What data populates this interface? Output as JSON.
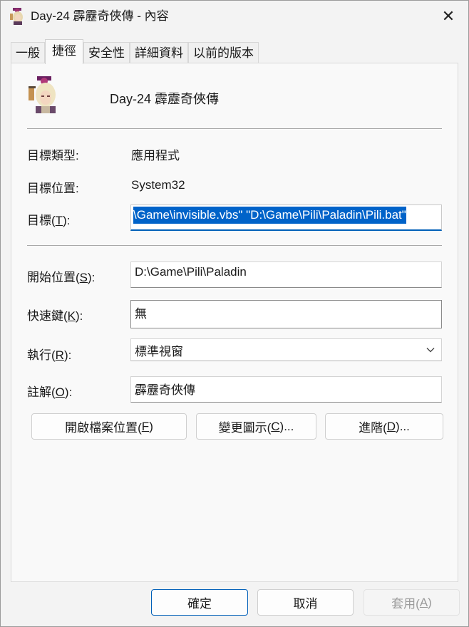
{
  "window": {
    "title": "Day-24 霹靂奇俠傳 - 內容",
    "close_glyph": "✕"
  },
  "tabs": [
    {
      "label": "一般",
      "active": false
    },
    {
      "label": "捷徑",
      "active": true
    },
    {
      "label": "安全性",
      "active": false
    },
    {
      "label": "詳細資料",
      "active": false
    },
    {
      "label": "以前的版本",
      "active": false
    }
  ],
  "shortcut": {
    "name": "Day-24 霹靂奇俠傳",
    "target_type": {
      "label": "目標類型:",
      "value": "應用程式"
    },
    "target_location": {
      "label": "目標位置:",
      "value": "System32"
    },
    "target": {
      "label_pre": "目標(",
      "label_key": "T",
      "label_post": "):",
      "value": "\\Game\\invisible.vbs\" \"D:\\Game\\Pili\\Paladin\\Pili.bat\""
    },
    "start_in": {
      "label_pre": "開始位置(",
      "label_key": "S",
      "label_post": "):",
      "value": "D:\\Game\\Pili\\Paladin"
    },
    "shortcut_key": {
      "label_pre": "快速鍵(",
      "label_key": "K",
      "label_post": "):",
      "value": "無"
    },
    "run": {
      "label_pre": "執行(",
      "label_key": "R",
      "label_post": "):",
      "value": "標準視窗"
    },
    "comment": {
      "label_pre": "註解(",
      "label_key": "O",
      "label_post": "):",
      "value": "霹靂奇俠傳"
    }
  },
  "actions": {
    "open_location": {
      "pre": "開啟檔案位置(",
      "key": "F",
      "post": ")"
    },
    "change_icon": {
      "pre": "變更圖示(",
      "key": "C",
      "post": ")..."
    },
    "advanced": {
      "pre": "進階(",
      "key": "D",
      "post": ")..."
    }
  },
  "footer": {
    "ok": "確定",
    "cancel": "取消",
    "apply": {
      "pre": "套用(",
      "key": "A",
      "post": ")"
    }
  },
  "icons": {
    "title_icon": "character-portrait-icon",
    "app_icon": "character-portrait-icon",
    "close": "close-icon",
    "dropdown": "chevron-down-icon"
  },
  "colors": {
    "selection": "#0063c9",
    "focus_underline": "#005fb8",
    "primary_border": "#005fb8"
  }
}
